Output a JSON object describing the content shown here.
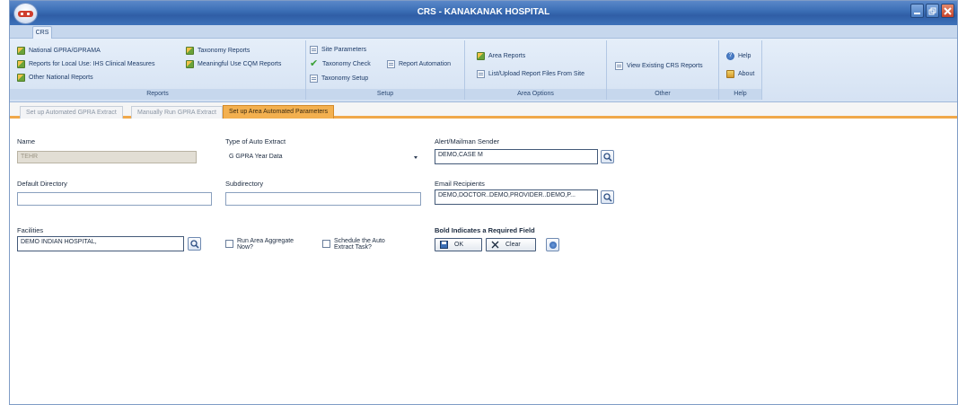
{
  "window": {
    "title": "CRS - KANAKANAK HOSPITAL"
  },
  "ribbon_tab": "CRS",
  "ribbon": {
    "reports": {
      "label": "Reports",
      "items": [
        "National GPRA/GPRAMA",
        "Reports for Local Use: IHS Clinical Measures",
        "Other National Reports",
        "Taxonomy Reports",
        "Meaningful Use CQM Reports"
      ]
    },
    "setup": {
      "label": "Setup",
      "items": [
        "Site Parameters",
        "Taxonomy Check",
        "Report Automation",
        "Taxonomy Setup"
      ]
    },
    "area_options": {
      "label": "Area Options",
      "items": [
        "Area Reports",
        "List/Upload Report Files From Site"
      ]
    },
    "other": {
      "label": "Other",
      "items": [
        "View Existing CRS Reports"
      ]
    },
    "help": {
      "label": "Help",
      "items": [
        "Help",
        "About"
      ]
    }
  },
  "subtabs": [
    "Set up Automated GPRA Extract",
    "Manually Run GPRA Extract",
    "Set up Area Automated Parameters"
  ],
  "form": {
    "name": {
      "label": "Name",
      "value": "TEHR"
    },
    "type_of_auto_extract": {
      "label": "Type of Auto Extract",
      "value": "G GPRA Year Data"
    },
    "alert_sender": {
      "label": "Alert/Mailman Sender",
      "value": "DEMO,CASE M"
    },
    "default_directory": {
      "label": "Default Directory",
      "value": ""
    },
    "subdirectory": {
      "label": "Subdirectory",
      "value": ""
    },
    "email_recipients": {
      "label": "Email Recipients",
      "value": "DEMO,DOCTOR..DEMO,PROVIDER..DEMO,P..."
    },
    "facilities": {
      "label": "Facilities",
      "value": "DEMO INDIAN HOSPITAL,"
    },
    "run_area_aggregate": {
      "line1": "Run Area Aggregate",
      "line2": "Now?"
    },
    "schedule_auto_extract": {
      "line1": "Schedule the Auto",
      "line2": "Extract Task?"
    },
    "required_note": "Bold Indicates a Required Field",
    "ok_label": "OK",
    "clear_label": "Clear"
  }
}
